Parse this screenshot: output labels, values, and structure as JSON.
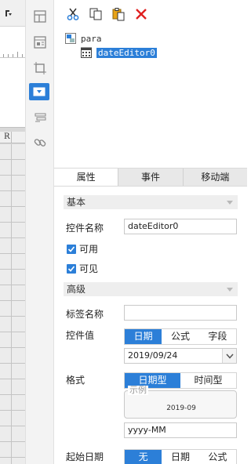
{
  "left_sheet": {
    "column_header": "R"
  },
  "toolbar": {
    "items": [
      {
        "icon": "grid-layout-icon"
      },
      {
        "icon": "form-table-icon"
      },
      {
        "icon": "frame-icon"
      },
      {
        "icon": "dropdown-widget-icon",
        "active": true
      },
      {
        "icon": "list-icon"
      },
      {
        "icon": "link-icon"
      }
    ]
  },
  "tree_toolbar": {
    "items": [
      {
        "icon": "cut-icon"
      },
      {
        "icon": "copy-icon"
      },
      {
        "icon": "paste-icon"
      },
      {
        "icon": "delete-icon"
      }
    ]
  },
  "tree": {
    "root": "para",
    "child": "dateEditor0"
  },
  "tabs": [
    "属性",
    "事件",
    "移动端"
  ],
  "basic_section": {
    "title": "基本",
    "control_name_label": "控件名称",
    "control_name_value": "dateEditor0",
    "enabled_label": "可用",
    "visible_label": "可见"
  },
  "advanced_section": {
    "title": "高级",
    "tag_name_label": "标签名称",
    "tag_name_value": "",
    "control_value_label": "控件值",
    "control_value_options": [
      "日期",
      "公式",
      "字段"
    ],
    "control_value_selected": "日期",
    "date_value": "2019/09/24",
    "format_label": "格式",
    "format_options": [
      "日期型",
      "时间型"
    ],
    "format_selected": "日期型",
    "example_legend": "示例",
    "example_value": "2019-09",
    "format_pattern": "yyyy-MM",
    "start_date_label": "起始日期",
    "start_date_options": [
      "无",
      "日期",
      "公式"
    ],
    "start_date_selected": "无"
  },
  "colors": {
    "accent": "#2c7fd8",
    "delete": "#e02020"
  }
}
